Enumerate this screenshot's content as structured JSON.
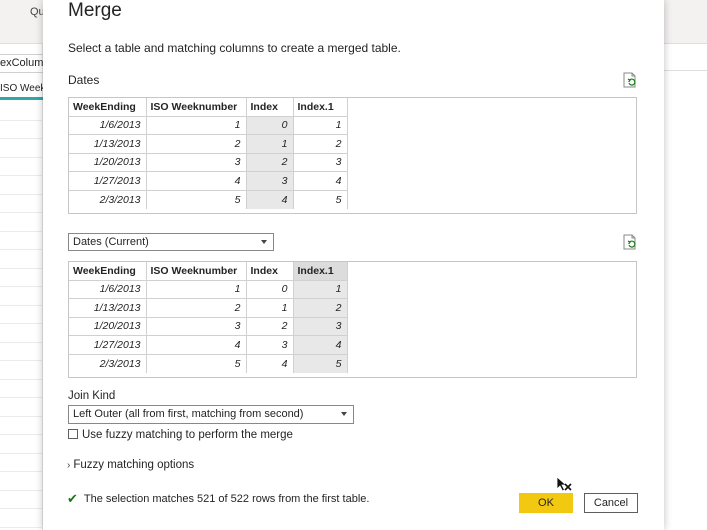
{
  "background": {
    "ribbon_text": "Qu",
    "formula_text": "exColum",
    "column_header": "ISO Week"
  },
  "dialog": {
    "title": "Merge",
    "subtitle": "Select a table and matching columns to create a merged table.",
    "first_table": {
      "label": "Dates",
      "refresh_icon": "refresh-preview-icon",
      "headers": [
        "WeekEnding",
        "ISO Weeknumber",
        "Index",
        "Index.1"
      ],
      "selected_column": "Index",
      "rows": [
        [
          "1/6/2013",
          "1",
          "0",
          "1"
        ],
        [
          "1/13/2013",
          "2",
          "1",
          "2"
        ],
        [
          "1/20/2013",
          "3",
          "2",
          "3"
        ],
        [
          "1/27/2013",
          "4",
          "3",
          "4"
        ],
        [
          "2/3/2013",
          "5",
          "4",
          "5"
        ]
      ]
    },
    "second_table": {
      "dropdown_value": "Dates (Current)",
      "refresh_icon": "refresh-preview-icon",
      "headers": [
        "WeekEnding",
        "ISO Weeknumber",
        "Index",
        "Index.1"
      ],
      "selected_column": "Index.1",
      "rows": [
        [
          "1/6/2013",
          "1",
          "0",
          "1"
        ],
        [
          "1/13/2013",
          "2",
          "1",
          "2"
        ],
        [
          "1/20/2013",
          "3",
          "2",
          "3"
        ],
        [
          "1/27/2013",
          "4",
          "3",
          "4"
        ],
        [
          "2/3/2013",
          "5",
          "4",
          "5"
        ]
      ]
    },
    "join_kind": {
      "label": "Join Kind",
      "value": "Left Outer (all from first, matching from second)"
    },
    "fuzzy_checkbox_label": "Use fuzzy matching to perform the merge",
    "fuzzy_options_label": "Fuzzy matching options",
    "status_text": "The selection matches 521 of 522 rows from the first table.",
    "buttons": {
      "ok": "OK",
      "cancel": "Cancel"
    },
    "colors": {
      "ok_button": "#f2c811",
      "selected_column": "#e8e8e8",
      "check": "#107c10"
    }
  }
}
